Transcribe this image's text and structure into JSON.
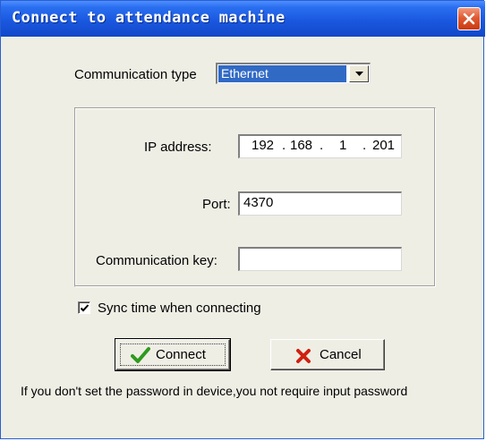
{
  "window": {
    "title": "Connect to attendance machine"
  },
  "form": {
    "comm_type_label": "Communication type",
    "comm_type_value": "Ethernet",
    "ip_label": "IP address:",
    "ip_segments": [
      "192",
      "168",
      "1",
      "201"
    ],
    "ip_dots": [
      ".",
      ".",
      "."
    ],
    "port_label": "Port:",
    "port_value": "4370",
    "key_label": "Communication key:",
    "key_value": ""
  },
  "sync": {
    "label": "Sync time when connecting",
    "checked": true
  },
  "buttons": {
    "connect": "Connect",
    "cancel": "Cancel"
  },
  "hint": "If you don't set the password in device,you not require input password",
  "colors": {
    "titlebar": "#1a58e0",
    "dialog_bg": "#efeee5",
    "selection": "#316ac5",
    "close_button": "#e05a33",
    "connect_icon": "#2e9a1f",
    "cancel_icon": "#d02010"
  },
  "icons": {
    "close": "close-icon",
    "dropdown": "chevron-down-icon",
    "check": "checkmark-icon",
    "connect": "green-checkmark-icon",
    "cancel": "red-x-icon"
  }
}
